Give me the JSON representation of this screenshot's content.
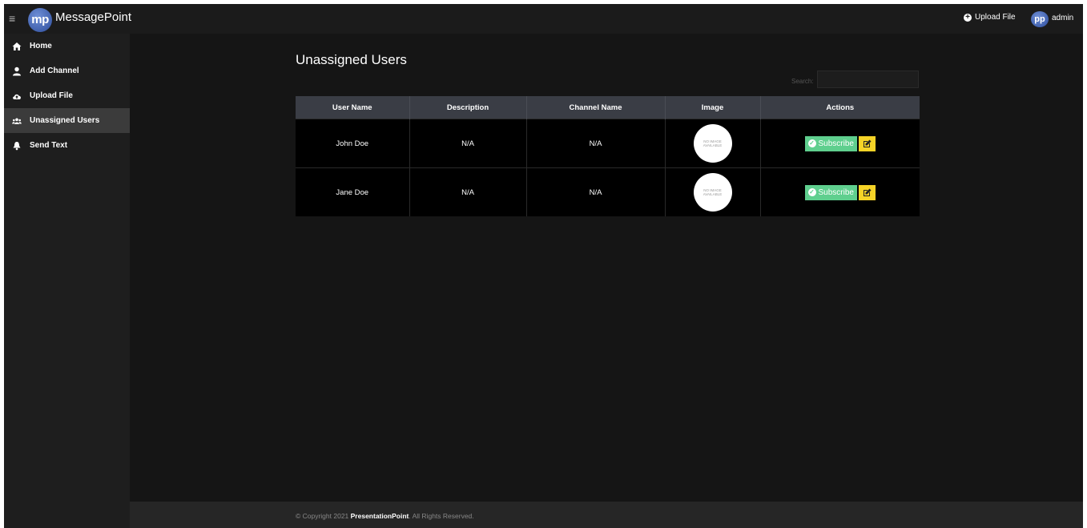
{
  "app": {
    "brand_logo": "mp",
    "brand_name": "MessagePoint"
  },
  "topbar": {
    "menu_icon": "≡",
    "upload_label": "Upload File",
    "avatar_initials": "pp",
    "username": "admin"
  },
  "sidebar": {
    "items": [
      {
        "label": "Home",
        "icon": "home-icon",
        "active": false
      },
      {
        "label": "Add Channel",
        "icon": "user-icon",
        "active": false
      },
      {
        "label": "Upload File",
        "icon": "cloud-upload-icon",
        "active": false
      },
      {
        "label": "Unassigned Users",
        "icon": "users-icon",
        "active": true
      },
      {
        "label": "Send Text",
        "icon": "bell-icon",
        "active": false
      }
    ]
  },
  "main": {
    "title": "Unassigned Users",
    "search_label": "Search:",
    "search_value": ""
  },
  "table": {
    "headers": [
      "User Name",
      "Description",
      "Channel Name",
      "Image",
      "Actions"
    ],
    "rows": [
      {
        "user_name": "John Doe",
        "description": "N/A",
        "channel_name": "N/A",
        "image_line1": "NO IMAGE",
        "image_line2": "AVAILABLE",
        "subscribe_label": "Subscribe"
      },
      {
        "user_name": "Jane Doe",
        "description": "N/A",
        "channel_name": "N/A",
        "image_line1": "NO IMAGE",
        "image_line2": "AVAILABLE",
        "subscribe_label": "Subscribe"
      }
    ]
  },
  "footer": {
    "prefix": "© Copyright 2021 ",
    "company": "PresentationPoint",
    "suffix": ". All Rights Reserved."
  },
  "colors": {
    "background": "#151515",
    "topbar": "#1b1b1b",
    "sidebar": "#1e1e1e",
    "sidebar_active": "#3b3b3b",
    "table_header": "#3a3d45",
    "subscribe_button": "#5fcf8e",
    "edit_button": "#f5d327",
    "brand_accent": "#3d5fb5"
  }
}
